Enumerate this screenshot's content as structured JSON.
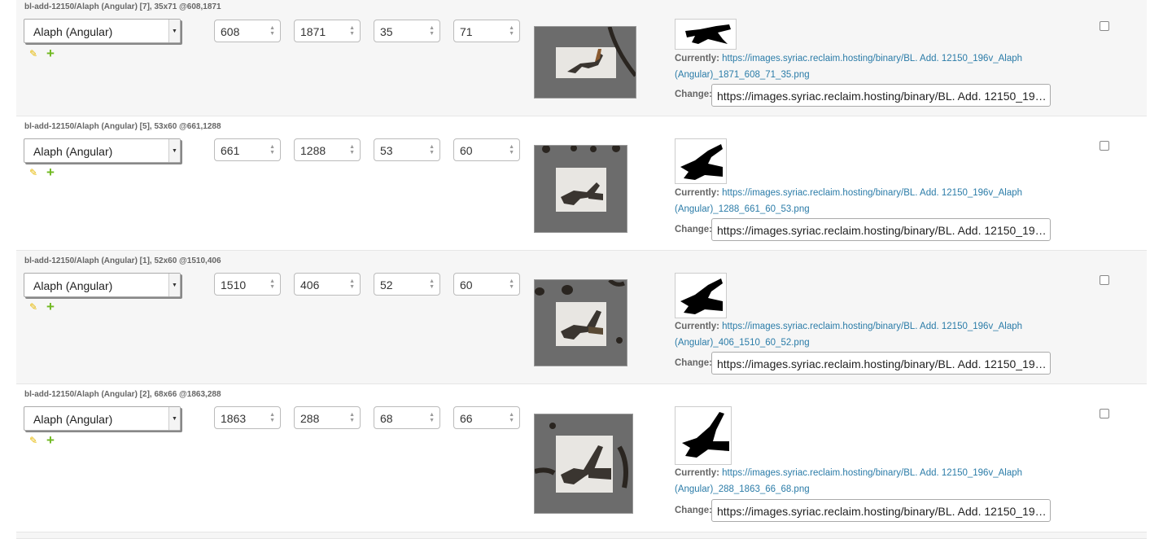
{
  "rows": [
    {
      "label": "bl-add-12150/Alaph (Angular) [7], 35x71 @608,1871",
      "letter": "Alaph (Angular)",
      "x": "608",
      "y": "1871",
      "w": "35",
      "h": "71",
      "current_label": "Currently:",
      "current_url": "https://images.syriac.reclaim.hosting/binary/BL. Add. 12150_196v_Alaph (Angular)_1871_608_71_35.png",
      "change_label": "Change:",
      "change_value": "https://images.syriac.reclaim.hosting/binary/BL. Add. 12150_196v_Alaph (Angular)_1871_608_71_35.png"
    },
    {
      "label": "bl-add-12150/Alaph (Angular) [5], 53x60 @661,1288",
      "letter": "Alaph (Angular)",
      "x": "661",
      "y": "1288",
      "w": "53",
      "h": "60",
      "current_label": "Currently:",
      "current_url": "https://images.syriac.reclaim.hosting/binary/BL. Add. 12150_196v_Alaph (Angular)_1288_661_60_53.png",
      "change_label": "Change:",
      "change_value": "https://images.syriac.reclaim.hosting/binary/BL. Add. 12150_196v_Alaph (Angular)_1288_661_60_53.png"
    },
    {
      "label": "bl-add-12150/Alaph (Angular) [1], 52x60 @1510,406",
      "letter": "Alaph (Angular)",
      "x": "1510",
      "y": "406",
      "w": "52",
      "h": "60",
      "current_label": "Currently:",
      "current_url": "https://images.syriac.reclaim.hosting/binary/BL. Add. 12150_196v_Alaph (Angular)_406_1510_60_52.png",
      "change_label": "Change:",
      "change_value": "https://images.syriac.reclaim.hosting/binary/BL. Add. 12150_196v_Alaph (Angular)_406_1510_60_52.png"
    },
    {
      "label": "bl-add-12150/Alaph (Angular) [2], 68x66 @1863,288",
      "letter": "Alaph (Angular)",
      "x": "1863",
      "y": "288",
      "w": "68",
      "h": "66",
      "current_label": "Currently:",
      "current_url": "https://images.syriac.reclaim.hosting/binary/BL. Add. 12150_196v_Alaph (Angular)_288_1863_66_68.png",
      "change_label": "Change:",
      "change_value": "https://images.syriac.reclaim.hosting/binary/BL. Add. 12150_196v_Alaph (Angular)_288_1863_66_68.png"
    }
  ],
  "icons": {
    "edit": "pencil-icon",
    "add": "plus-icon",
    "spinner": "spinner-arrows-icon",
    "dropdown": "caret-down-icon"
  }
}
